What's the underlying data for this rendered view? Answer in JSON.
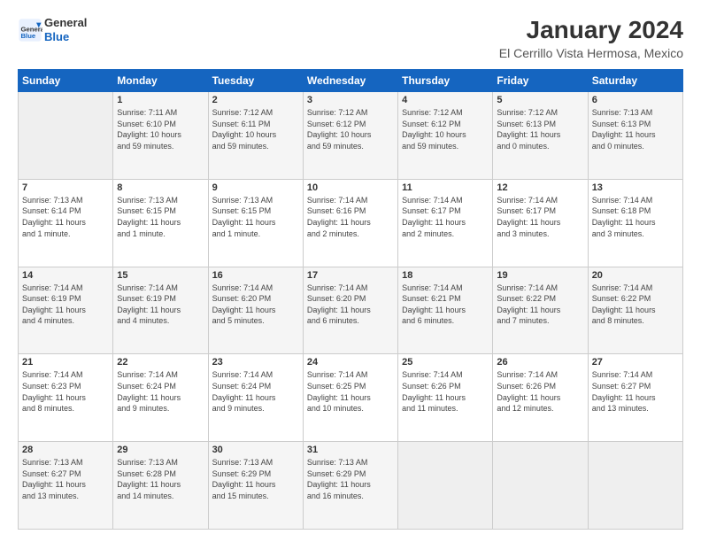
{
  "header": {
    "logo_line1": "General",
    "logo_line2": "Blue",
    "title": "January 2024",
    "subtitle": "El Cerrillo Vista Hermosa, Mexico"
  },
  "calendar": {
    "days_of_week": [
      "Sunday",
      "Monday",
      "Tuesday",
      "Wednesday",
      "Thursday",
      "Friday",
      "Saturday"
    ],
    "weeks": [
      [
        {
          "day": "",
          "info": ""
        },
        {
          "day": "1",
          "info": "Sunrise: 7:11 AM\nSunset: 6:10 PM\nDaylight: 10 hours\nand 59 minutes."
        },
        {
          "day": "2",
          "info": "Sunrise: 7:12 AM\nSunset: 6:11 PM\nDaylight: 10 hours\nand 59 minutes."
        },
        {
          "day": "3",
          "info": "Sunrise: 7:12 AM\nSunset: 6:12 PM\nDaylight: 10 hours\nand 59 minutes."
        },
        {
          "day": "4",
          "info": "Sunrise: 7:12 AM\nSunset: 6:12 PM\nDaylight: 10 hours\nand 59 minutes."
        },
        {
          "day": "5",
          "info": "Sunrise: 7:12 AM\nSunset: 6:13 PM\nDaylight: 11 hours\nand 0 minutes."
        },
        {
          "day": "6",
          "info": "Sunrise: 7:13 AM\nSunset: 6:13 PM\nDaylight: 11 hours\nand 0 minutes."
        }
      ],
      [
        {
          "day": "7",
          "info": "Sunrise: 7:13 AM\nSunset: 6:14 PM\nDaylight: 11 hours\nand 1 minute."
        },
        {
          "day": "8",
          "info": "Sunrise: 7:13 AM\nSunset: 6:15 PM\nDaylight: 11 hours\nand 1 minute."
        },
        {
          "day": "9",
          "info": "Sunrise: 7:13 AM\nSunset: 6:15 PM\nDaylight: 11 hours\nand 1 minute."
        },
        {
          "day": "10",
          "info": "Sunrise: 7:14 AM\nSunset: 6:16 PM\nDaylight: 11 hours\nand 2 minutes."
        },
        {
          "day": "11",
          "info": "Sunrise: 7:14 AM\nSunset: 6:17 PM\nDaylight: 11 hours\nand 2 minutes."
        },
        {
          "day": "12",
          "info": "Sunrise: 7:14 AM\nSunset: 6:17 PM\nDaylight: 11 hours\nand 3 minutes."
        },
        {
          "day": "13",
          "info": "Sunrise: 7:14 AM\nSunset: 6:18 PM\nDaylight: 11 hours\nand 3 minutes."
        }
      ],
      [
        {
          "day": "14",
          "info": "Sunrise: 7:14 AM\nSunset: 6:19 PM\nDaylight: 11 hours\nand 4 minutes."
        },
        {
          "day": "15",
          "info": "Sunrise: 7:14 AM\nSunset: 6:19 PM\nDaylight: 11 hours\nand 4 minutes."
        },
        {
          "day": "16",
          "info": "Sunrise: 7:14 AM\nSunset: 6:20 PM\nDaylight: 11 hours\nand 5 minutes."
        },
        {
          "day": "17",
          "info": "Sunrise: 7:14 AM\nSunset: 6:20 PM\nDaylight: 11 hours\nand 6 minutes."
        },
        {
          "day": "18",
          "info": "Sunrise: 7:14 AM\nSunset: 6:21 PM\nDaylight: 11 hours\nand 6 minutes."
        },
        {
          "day": "19",
          "info": "Sunrise: 7:14 AM\nSunset: 6:22 PM\nDaylight: 11 hours\nand 7 minutes."
        },
        {
          "day": "20",
          "info": "Sunrise: 7:14 AM\nSunset: 6:22 PM\nDaylight: 11 hours\nand 8 minutes."
        }
      ],
      [
        {
          "day": "21",
          "info": "Sunrise: 7:14 AM\nSunset: 6:23 PM\nDaylight: 11 hours\nand 8 minutes."
        },
        {
          "day": "22",
          "info": "Sunrise: 7:14 AM\nSunset: 6:24 PM\nDaylight: 11 hours\nand 9 minutes."
        },
        {
          "day": "23",
          "info": "Sunrise: 7:14 AM\nSunset: 6:24 PM\nDaylight: 11 hours\nand 9 minutes."
        },
        {
          "day": "24",
          "info": "Sunrise: 7:14 AM\nSunset: 6:25 PM\nDaylight: 11 hours\nand 10 minutes."
        },
        {
          "day": "25",
          "info": "Sunrise: 7:14 AM\nSunset: 6:26 PM\nDaylight: 11 hours\nand 11 minutes."
        },
        {
          "day": "26",
          "info": "Sunrise: 7:14 AM\nSunset: 6:26 PM\nDaylight: 11 hours\nand 12 minutes."
        },
        {
          "day": "27",
          "info": "Sunrise: 7:14 AM\nSunset: 6:27 PM\nDaylight: 11 hours\nand 13 minutes."
        }
      ],
      [
        {
          "day": "28",
          "info": "Sunrise: 7:13 AM\nSunset: 6:27 PM\nDaylight: 11 hours\nand 13 minutes."
        },
        {
          "day": "29",
          "info": "Sunrise: 7:13 AM\nSunset: 6:28 PM\nDaylight: 11 hours\nand 14 minutes."
        },
        {
          "day": "30",
          "info": "Sunrise: 7:13 AM\nSunset: 6:29 PM\nDaylight: 11 hours\nand 15 minutes."
        },
        {
          "day": "31",
          "info": "Sunrise: 7:13 AM\nSunset: 6:29 PM\nDaylight: 11 hours\nand 16 minutes."
        },
        {
          "day": "",
          "info": ""
        },
        {
          "day": "",
          "info": ""
        },
        {
          "day": "",
          "info": ""
        }
      ]
    ]
  }
}
